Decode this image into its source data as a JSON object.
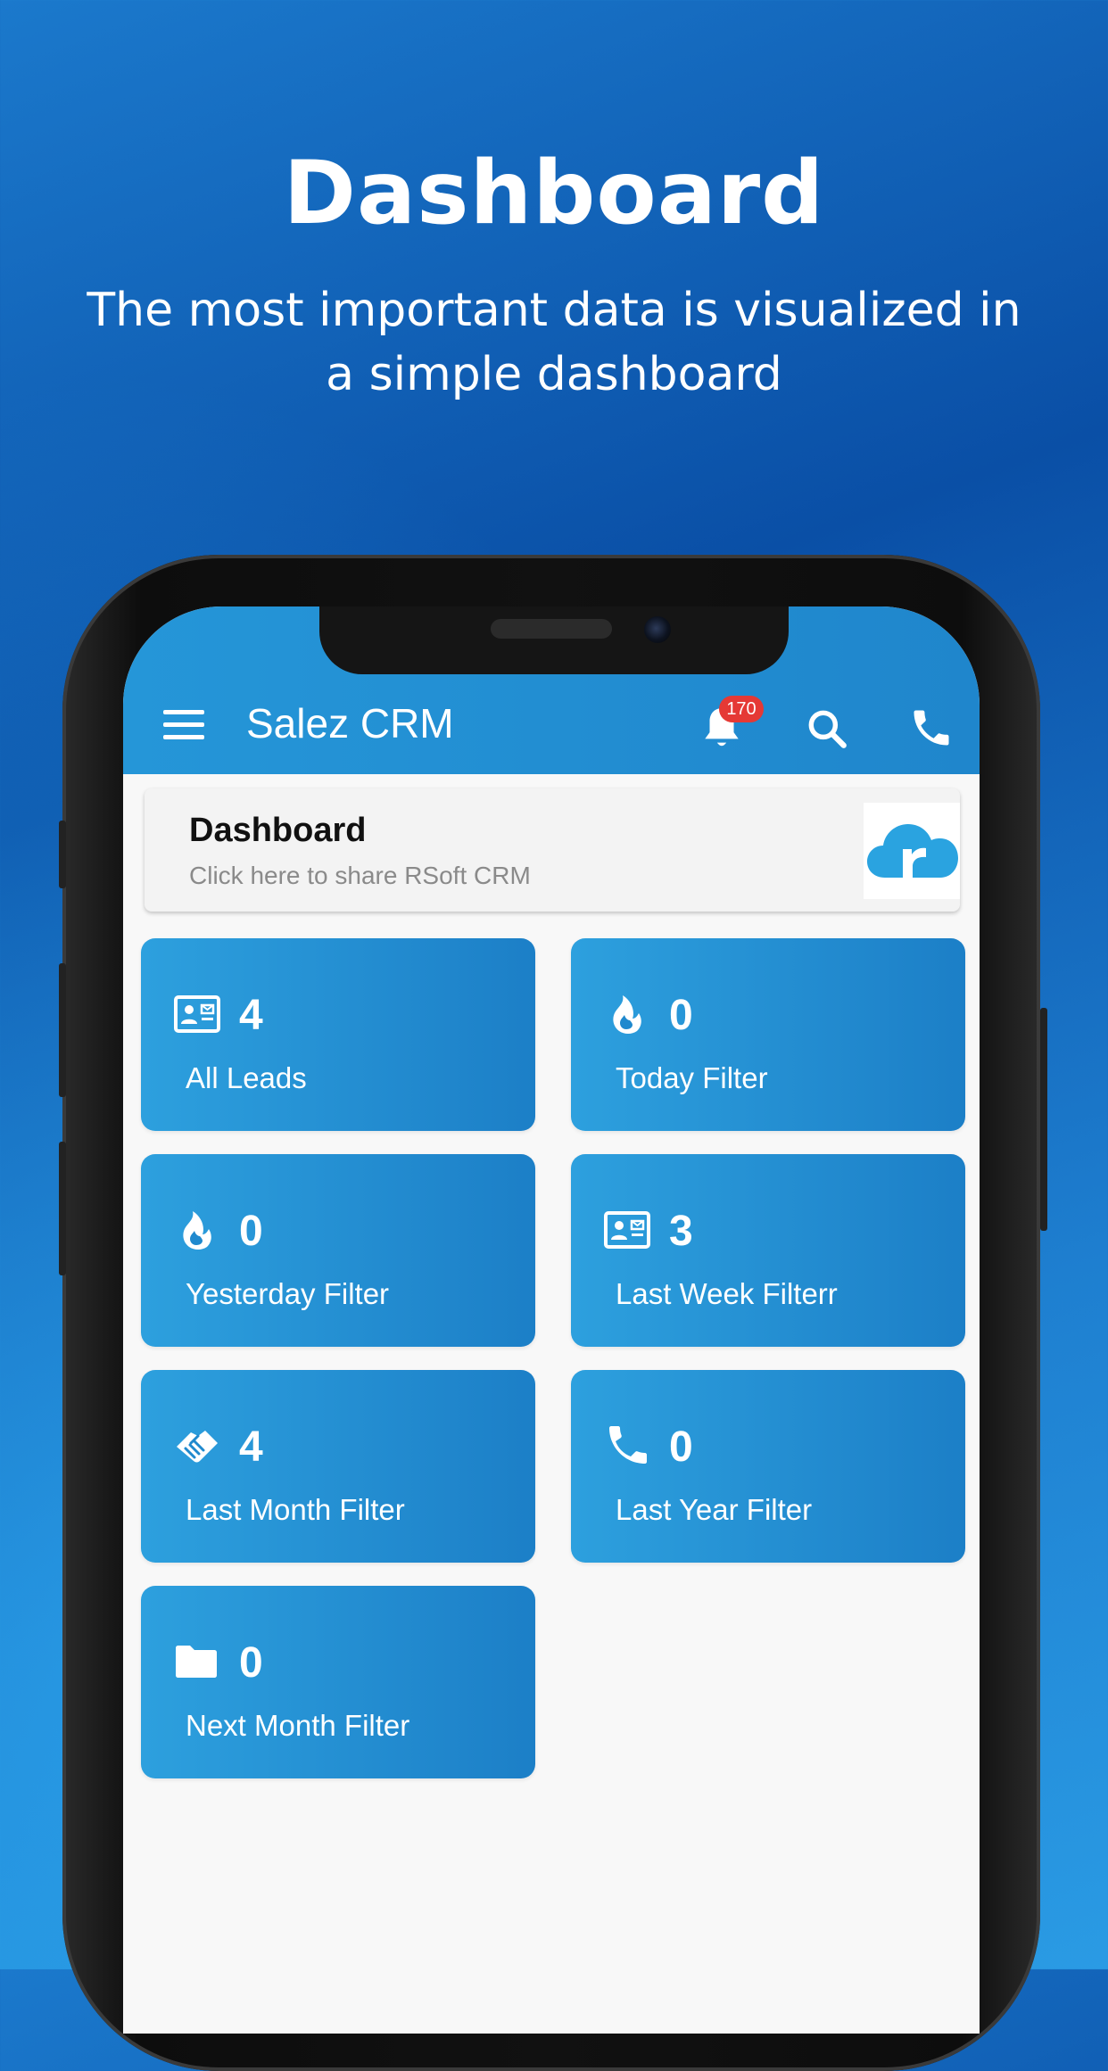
{
  "promo": {
    "title": "Dashboard",
    "subtitle": "The most important data is visualized in a simple dashboard"
  },
  "appbar": {
    "title": "Salez CRM",
    "notification_count": "170",
    "icons": [
      "menu-icon",
      "bell-icon",
      "search-icon",
      "phone-icon"
    ]
  },
  "share_card": {
    "title": "Dashboard",
    "subtitle": "Click here to share RSoft CRM",
    "logo_icon": "cloud-r-logo"
  },
  "tiles": [
    {
      "count": "4",
      "label": "All Leads",
      "icon": "contact-card-icon"
    },
    {
      "count": "0",
      "label": "Today Filter",
      "icon": "fire-icon"
    },
    {
      "count": "0",
      "label": "Yesterday Filter",
      "icon": "fire-icon"
    },
    {
      "count": "3",
      "label": "Last Week Filterr",
      "icon": "contact-card-icon"
    },
    {
      "count": "4",
      "label": "Last Month Filter",
      "icon": "handshake-icon"
    },
    {
      "count": "0",
      "label": "Last Year Filter",
      "icon": "phone-icon"
    },
    {
      "count": "0",
      "label": "Next Month Filter",
      "icon": "folder-icon"
    }
  ],
  "colors": {
    "background_top": "#0a4fa6",
    "background_bottom": "#2a9be4",
    "appbar": "#2596d8",
    "tile_start": "#2da0de",
    "tile_end": "#1c7fc7",
    "badge": "#e53935"
  }
}
